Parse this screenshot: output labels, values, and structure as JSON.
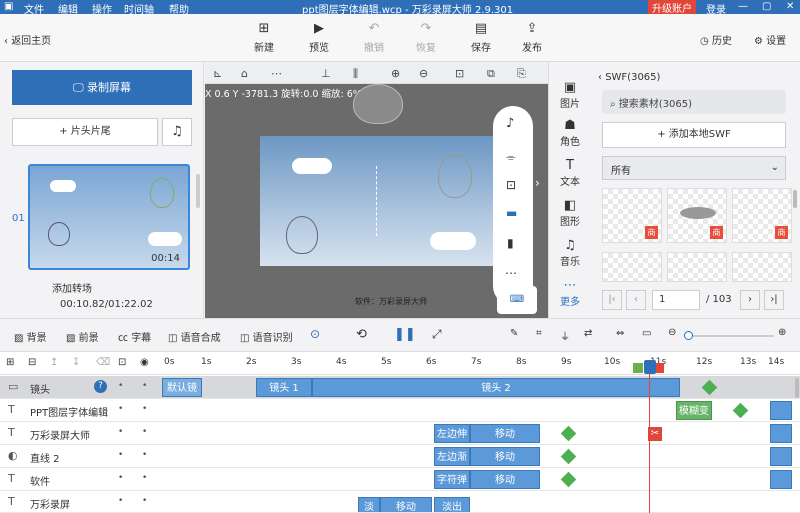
{
  "titlebar": {
    "menus": [
      "文件",
      "编辑",
      "操作",
      "时间轴",
      "帮助"
    ],
    "title": "ppt图层字体编辑.wcp - 万彩录屏大师 2.9.301",
    "upgrade": "升级账户",
    "login": "登录"
  },
  "toolbar": {
    "back": "返回主页",
    "new": "新建",
    "preview": "预览",
    "undo": "撤销",
    "redo": "恢复",
    "save": "保存",
    "publish": "发布",
    "history": "历史",
    "settings": "设置"
  },
  "left": {
    "record": "录制屏幕",
    "intro": "片头片尾",
    "scene_index": "01",
    "scene_duration": "00:14",
    "add_transition": "添加转场",
    "time": "00:10.82/01:22.02"
  },
  "canvas": {
    "coords": "X 0.6 Y -3781.3 旋转:0.0 缩放: 6%",
    "watermark": "软件：万彩录屏大师"
  },
  "categories": [
    {
      "label": "图片",
      "icon": "image-icon"
    },
    {
      "label": "角色",
      "icon": "character-icon"
    },
    {
      "label": "文本",
      "icon": "text-icon"
    },
    {
      "label": "图形",
      "icon": "shape-icon"
    },
    {
      "label": "音乐",
      "icon": "music-icon"
    },
    {
      "label": "更多",
      "icon": "more-icon"
    }
  ],
  "assets": {
    "header": "SWF(3065)",
    "search_placeholder": "搜索素材(3065)",
    "add_local": "添加本地SWF",
    "filter": "所有",
    "badge": "商",
    "page": "1",
    "total": "/ 103"
  },
  "timeline_toolbar": {
    "bg": "背景",
    "fg": "前景",
    "subtitle": "字幕",
    "tts": "语音合成",
    "asr": "语音识别"
  },
  "ruler": [
    "0s",
    "1s",
    "2s",
    "3s",
    "4s",
    "5s",
    "6s",
    "7s",
    "8s",
    "9s",
    "10s",
    "11s",
    "12s",
    "13s",
    "14s"
  ],
  "tracks": [
    {
      "name": "镜头",
      "clips": [
        "默认镜",
        "镜头 1",
        "镜头 2"
      ]
    },
    {
      "name": "PPT图层字体编辑",
      "clips": [
        "模糊变"
      ]
    },
    {
      "name": "万彩录屏大师",
      "clips": [
        "左边伸",
        "移动"
      ]
    },
    {
      "name": "直线 2",
      "clips": [
        "左边渐",
        "移动"
      ]
    },
    {
      "name": "软件",
      "clips": [
        "字符弹",
        "移动"
      ]
    },
    {
      "name": "万彩录屏",
      "clips": [
        "淡",
        "移动",
        "淡出"
      ]
    }
  ],
  "colors": {
    "accent": "#2f6fb8",
    "clip": "#5b99d8",
    "upgrade": "#e0463a",
    "keyframe": "#4caf50",
    "playhead": "#e0463a"
  }
}
